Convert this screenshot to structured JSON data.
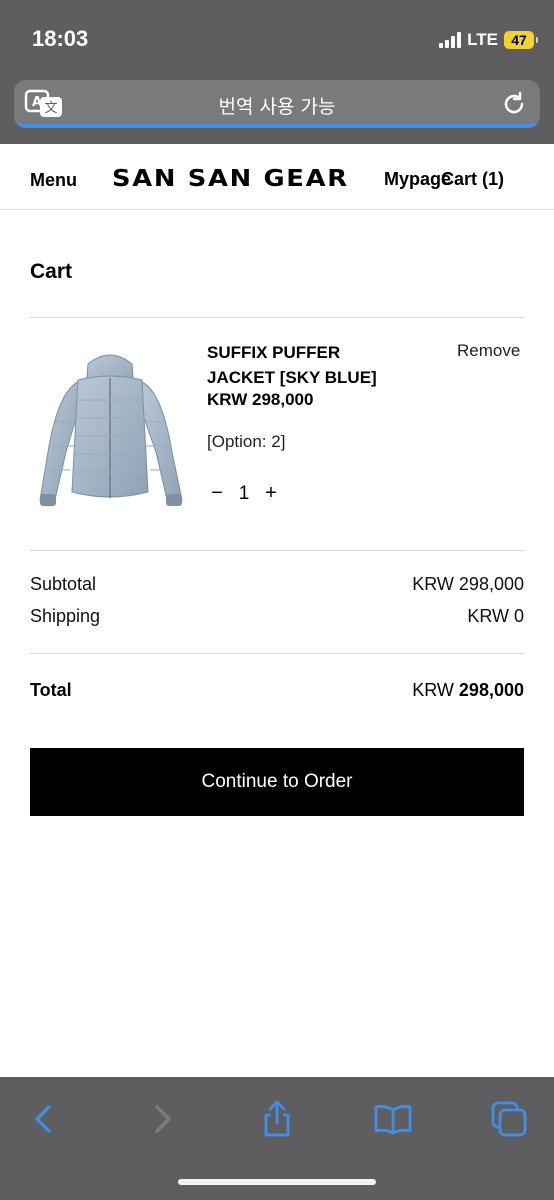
{
  "status": {
    "time": "18:03",
    "network": "LTE",
    "battery": "47"
  },
  "browser": {
    "url_text": "번역 사용 가능"
  },
  "header": {
    "menu": "Menu",
    "logo": "SAN SAN GEAR",
    "mypage": "Mypage",
    "cart": "Cart (1)"
  },
  "page": {
    "title": "Cart"
  },
  "cart_item": {
    "name_line1": "SUFFIX PUFFER",
    "name_line2": "JACKET [SKY BLUE]",
    "price": "KRW 298,000",
    "option": "[Option: 2]",
    "quantity": "1",
    "minus": "−",
    "plus": "+",
    "remove": "Remove"
  },
  "summary": {
    "subtotal_label": "Subtotal",
    "subtotal_value": "KRW 298,000",
    "shipping_label": "Shipping",
    "shipping_value": "KRW 0",
    "total_label": "Total",
    "total_currency": "KRW",
    "total_amount": "298,000"
  },
  "cta": {
    "label": "Continue to Order"
  },
  "colors": {
    "chrome": "#5e5e60",
    "accent_blue": "#3f8fe8",
    "button_bg": "#000000",
    "battery": "#f2d32e"
  },
  "icons": [
    "translate-icon",
    "reload-icon",
    "back-icon",
    "forward-icon",
    "share-icon",
    "bookmarks-icon",
    "tabs-icon"
  ]
}
